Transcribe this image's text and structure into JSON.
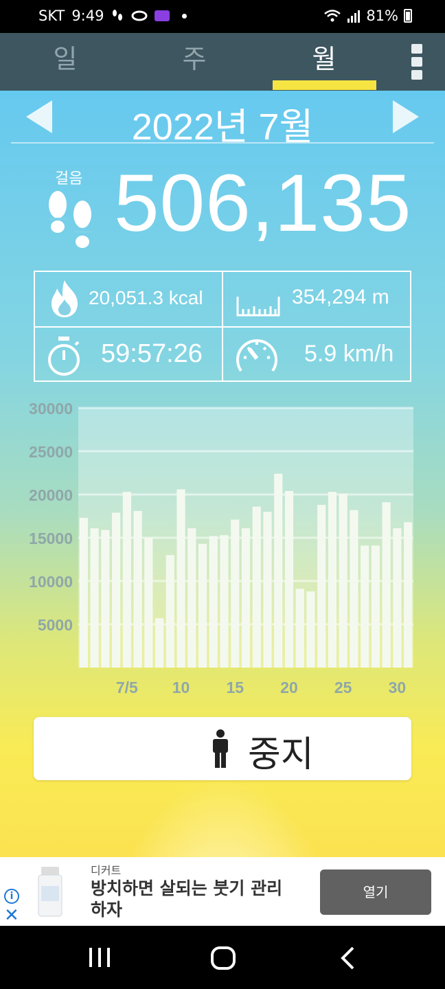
{
  "status_bar": {
    "carrier": "SKT",
    "time": "9:49",
    "battery": "81%"
  },
  "tabs": [
    {
      "label": "일",
      "active": false
    },
    {
      "label": "주",
      "active": false
    },
    {
      "label": "월",
      "active": true
    }
  ],
  "period": {
    "title": "2022년 7월"
  },
  "steps": {
    "label": "걸음",
    "value": "506,135"
  },
  "stats": {
    "calories": "20,051.3 kcal",
    "distance": "354,294 m",
    "duration": "59:57:26",
    "speed": "5.9 km/h"
  },
  "chart_data": {
    "type": "bar",
    "x": [
      1,
      2,
      3,
      4,
      5,
      6,
      7,
      8,
      9,
      10,
      11,
      12,
      13,
      14,
      15,
      16,
      17,
      18,
      19,
      20,
      21,
      22,
      23,
      24,
      25,
      26,
      27,
      28,
      29,
      30,
      31
    ],
    "values": [
      17300,
      16100,
      15900,
      17900,
      20300,
      18100,
      15000,
      5700,
      13000,
      20600,
      16100,
      14300,
      15200,
      15300,
      17100,
      16100,
      18600,
      18000,
      22400,
      20400,
      9100,
      8800,
      18800,
      20300,
      20100,
      18200,
      14100,
      14100,
      19100,
      16100,
      16800
    ],
    "x_tick_labels": [
      {
        "x": 5,
        "label": "7/5"
      },
      {
        "x": 10,
        "label": "10"
      },
      {
        "x": 15,
        "label": "15"
      },
      {
        "x": 20,
        "label": "20"
      },
      {
        "x": 25,
        "label": "25"
      },
      {
        "x": 30,
        "label": "30"
      }
    ],
    "y_ticks": [
      5000,
      10000,
      15000,
      20000,
      25000,
      30000
    ],
    "ylim": [
      0,
      30000
    ],
    "grid": true
  },
  "stop_button": {
    "label": "중지"
  },
  "ad": {
    "brand": "디커트",
    "headline": "방치하면 살되는 붓기 관리하자",
    "open_label": "열기"
  },
  "colors": {
    "tab_bar": "#3d5660",
    "tab_underline": "#f6e442",
    "gradient_top": "#66c9ef",
    "gradient_bottom": "#fbe250",
    "bar_fill": "#f4f9f0"
  }
}
